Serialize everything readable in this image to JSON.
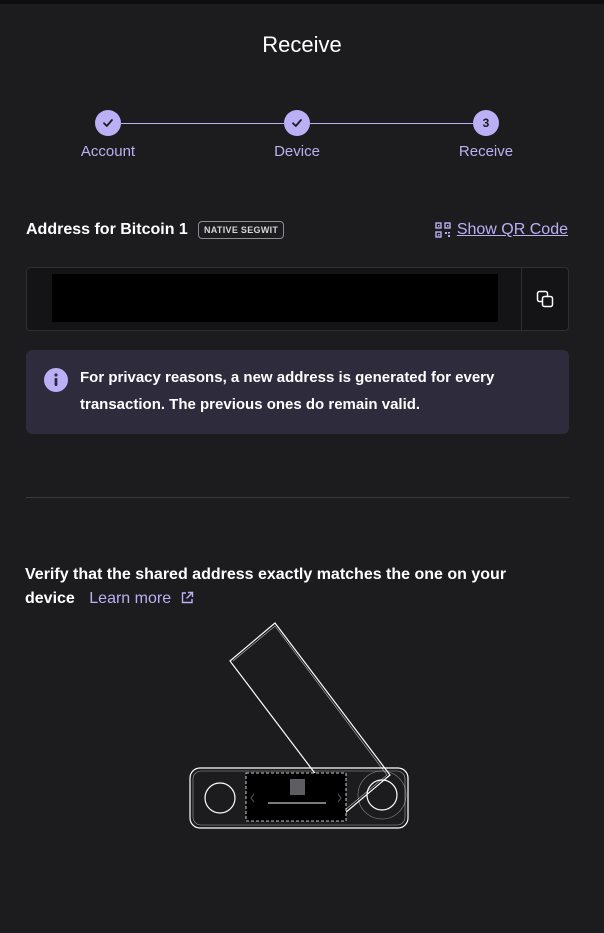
{
  "window": {
    "title": "Receive"
  },
  "stepper": {
    "steps": [
      {
        "label": "Account",
        "state": "done",
        "icon": "check-icon"
      },
      {
        "label": "Device",
        "state": "done",
        "icon": "check-icon"
      },
      {
        "label": "Receive",
        "state": "current",
        "number": "3"
      }
    ]
  },
  "address": {
    "label": "Address for Bitcoin 1",
    "badge": "NATIVE SEGWIT",
    "show_qr_label": "Show QR Code",
    "value": ""
  },
  "info": {
    "text": "For privacy reasons, a new address is generated for every transaction. The previous ones do remain valid."
  },
  "verify": {
    "text": "Verify that the shared address exactly matches the one on your device",
    "learn_more": "Learn more"
  },
  "colors": {
    "background": "#1c1c1e",
    "accent": "#bbb0f5",
    "info_bg": "#2d2b3c"
  }
}
